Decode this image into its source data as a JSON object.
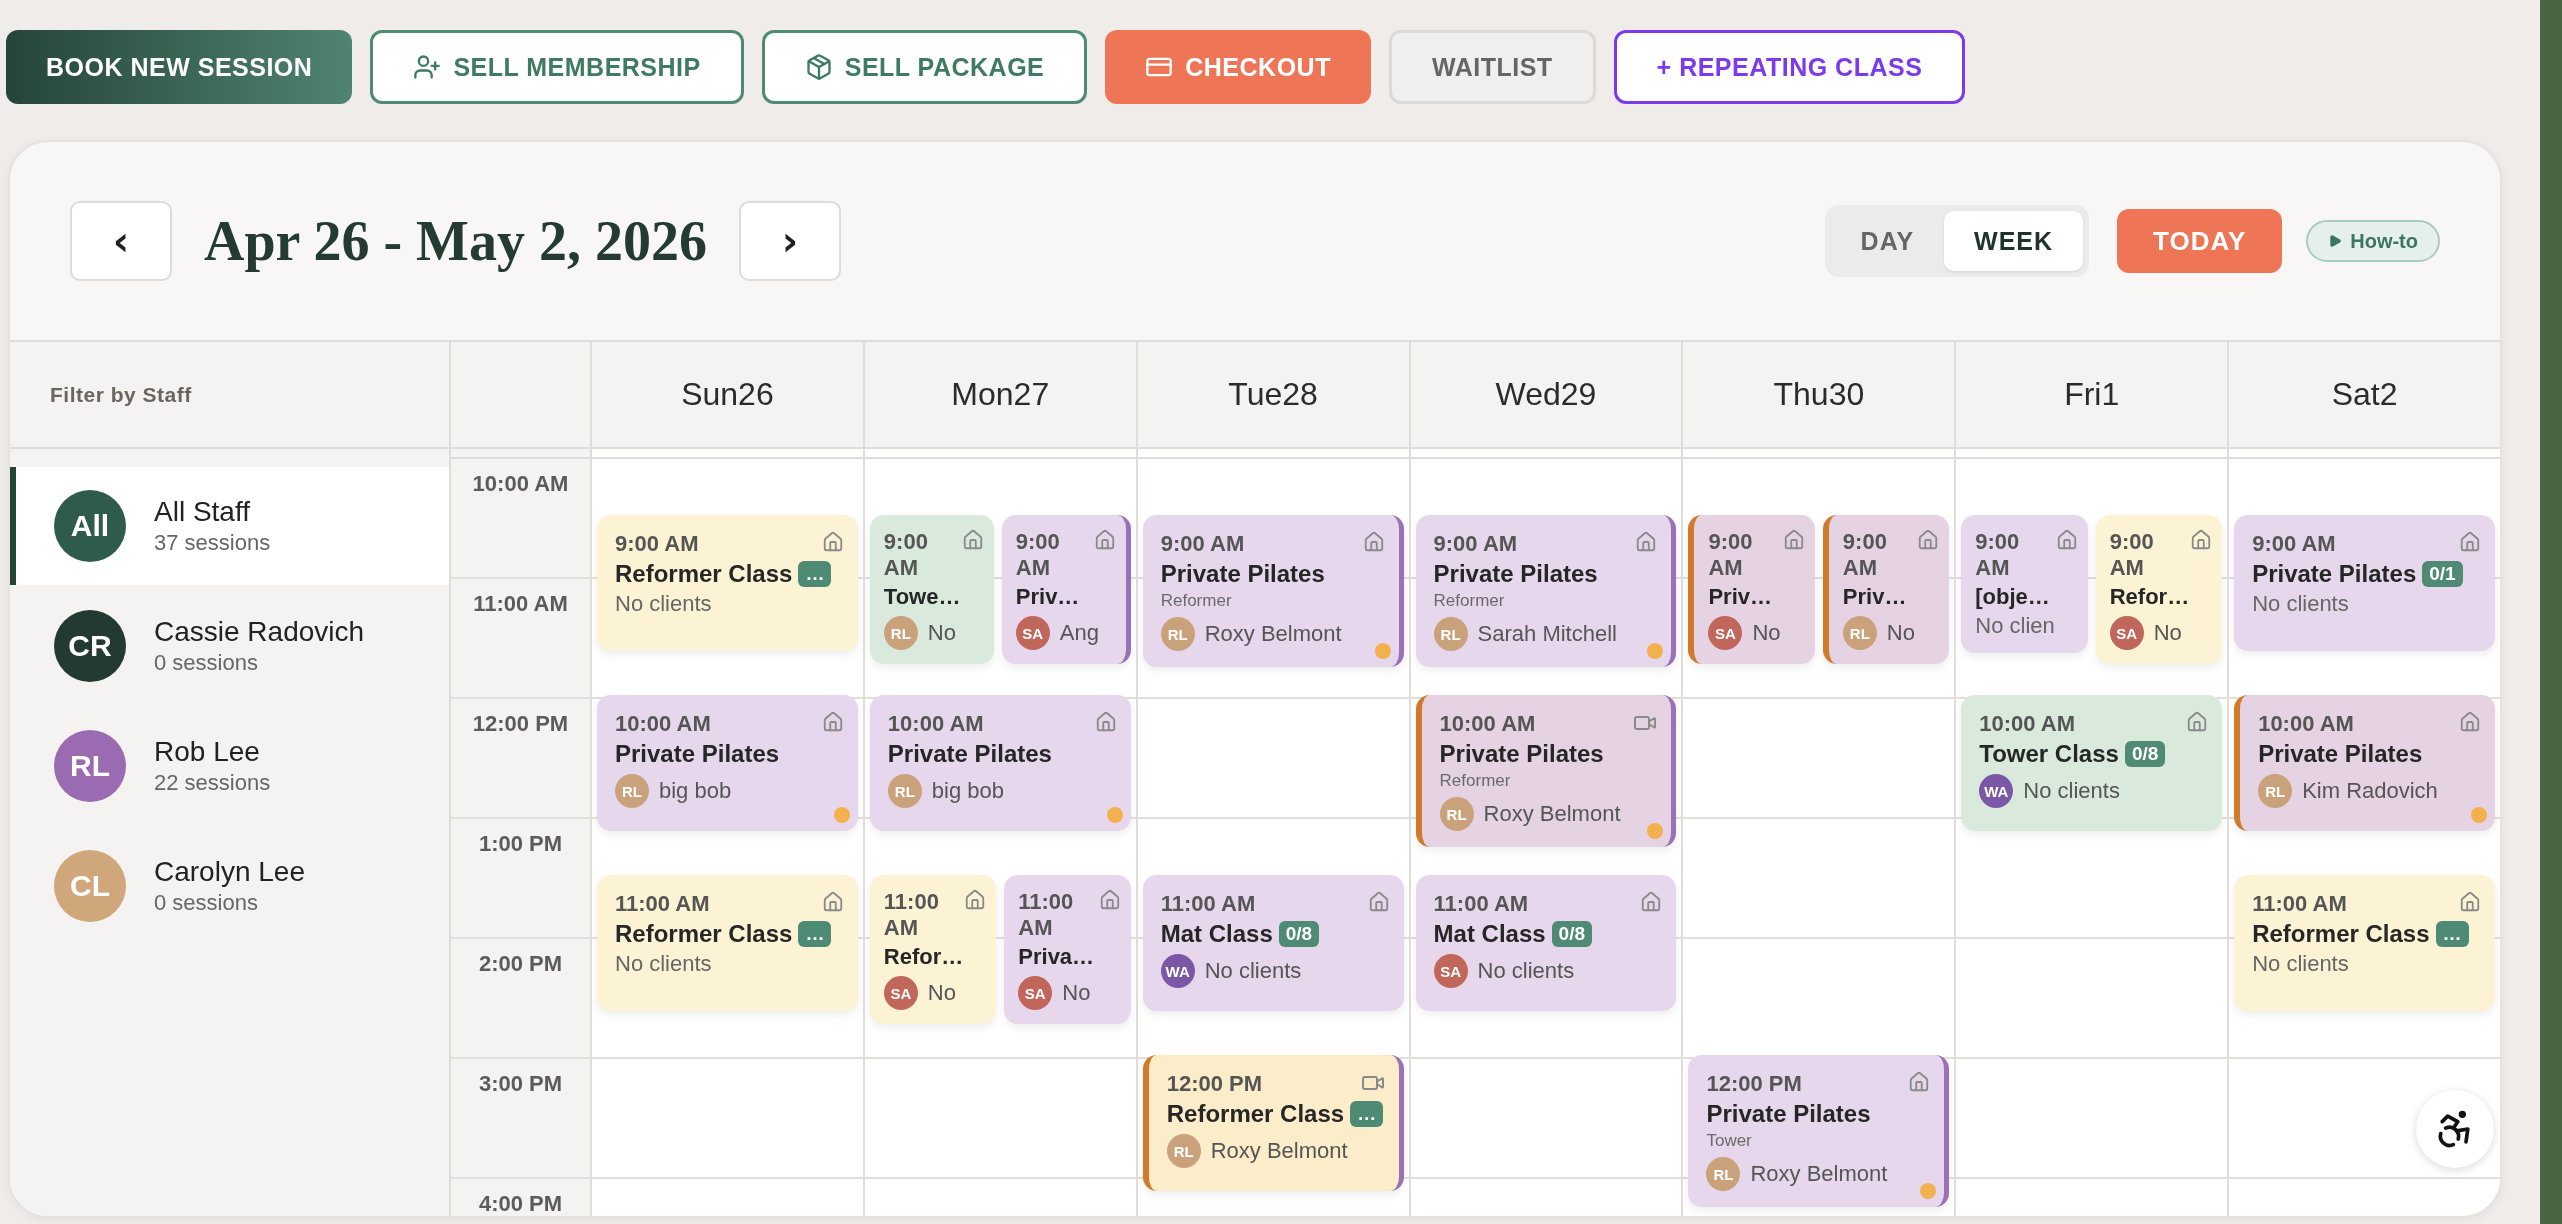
{
  "toolbar": [
    {
      "kind": "book",
      "label": "BOOK NEW SESSION"
    },
    {
      "kind": "membership",
      "label": "SELL MEMBERSHIP"
    },
    {
      "kind": "package",
      "label": "SELL PACKAGE"
    },
    {
      "kind": "checkout",
      "label": "CHECKOUT"
    },
    {
      "kind": "waitlist",
      "label": "WAITLIST"
    },
    {
      "kind": "repeating",
      "label": "+ REPEATING CLASS"
    }
  ],
  "calendar": {
    "prev": "‹",
    "next": "›",
    "title": "Apr 26 - May 2, 2026",
    "views": [
      {
        "label": "DAY",
        "selected": false
      },
      {
        "label": "WEEK",
        "selected": true
      }
    ],
    "today": "TODAY",
    "how_to": "How-to"
  },
  "staff_filter": {
    "heading": "Filter by Staff",
    "staff": [
      {
        "initials": "All",
        "name": "All Staff",
        "sessions": "37 sessions",
        "color": "#2f5b4c",
        "selected": true
      },
      {
        "initials": "CR",
        "name": "Cassie Radovich",
        "sessions": "0 sessions",
        "color": "#233a33",
        "selected": false
      },
      {
        "initials": "RL",
        "name": "Rob Lee",
        "sessions": "22 sessions",
        "color": "#9a6bb0",
        "selected": false
      },
      {
        "initials": "CL",
        "name": "Carolyn Lee",
        "sessions": "0 sessions",
        "color": "#cfa77a",
        "selected": false
      }
    ]
  },
  "times": [
    "10:00 AM",
    "11:00 AM",
    "12:00 PM",
    "1:00 PM",
    "2:00 PM",
    "3:00 PM",
    "4:00 PM"
  ],
  "days": [
    {
      "label": "Sun26",
      "slots": [
        {
          "kind": "nine",
          "events": [
            {
              "time": "9:00 AM",
              "title": "Reformer Class",
              "badge": "…",
              "note": "No clients",
              "kind": "in_person",
              "color": "#fbf3d3",
              "accent_left": false,
              "accent_right": false,
              "dot": false
            }
          ]
        },
        {
          "kind": "ten",
          "events": [
            {
              "time": "10:00 AM",
              "title": "Private Pilates",
              "client": {
                "initials": "RL",
                "name": "big bob",
                "color": "#c9a27c"
              },
              "kind": "in_person",
              "color": "#e6d7ec",
              "accent_left": false,
              "accent_right": false,
              "dot": true
            }
          ]
        },
        {
          "kind": "eleven",
          "events": [
            {
              "time": "11:00 AM",
              "title": "Reformer Class",
              "badge": "…",
              "note": "No clients",
              "kind": "in_person",
              "color": "#fbf3d3",
              "accent_left": false,
              "accent_right": false,
              "dot": false
            }
          ]
        }
      ]
    },
    {
      "label": "Mon27",
      "slots": [
        {
          "kind": "nine",
          "events": [
            {
              "time": "9:00 AM",
              "title": "Towe…",
              "client": {
                "initials": "RL",
                "name": "No",
                "color": "#c9a27c"
              },
              "kind": "in_person",
              "color": "#d9eadd",
              "accent_left": false,
              "accent_right": false,
              "dot": false
            },
            {
              "time": "9:00 AM",
              "title": "Priv…",
              "client": {
                "initials": "SA",
                "name": "Ang",
                "color": "#c1665a"
              },
              "kind": "in_person",
              "color": "#e6d7ec",
              "accent_left": false,
              "accent_right": true,
              "dot": false
            }
          ]
        },
        {
          "kind": "ten",
          "events": [
            {
              "time": "10:00 AM",
              "title": "Private Pilates",
              "client": {
                "initials": "RL",
                "name": "big bob",
                "color": "#c9a27c"
              },
              "kind": "in_person",
              "color": "#e6d7ec",
              "accent_left": false,
              "accent_right": false,
              "dot": true
            }
          ]
        },
        {
          "kind": "eleven",
          "events": [
            {
              "time": "11:00 AM",
              "title": "Refor…",
              "client": {
                "initials": "SA",
                "name": "No",
                "color": "#c1665a"
              },
              "kind": "in_person",
              "color": "#fbf3d3",
              "accent_left": false,
              "accent_right": false,
              "dot": false
            },
            {
              "time": "11:00 AM",
              "title": "Priva…",
              "client": {
                "initials": "SA",
                "name": "No",
                "color": "#c1665a"
              },
              "kind": "in_person",
              "color": "#e6d7ec",
              "accent_left": false,
              "accent_right": false,
              "dot": false
            }
          ]
        }
      ]
    },
    {
      "label": "Tue28",
      "slots": [
        {
          "kind": "nine",
          "events": [
            {
              "time": "9:00 AM",
              "title": "Private Pilates",
              "subtitle": "Reformer",
              "client": {
                "initials": "RL",
                "name": "Roxy Belmont",
                "color": "#c9a27c"
              },
              "kind": "in_person",
              "color": "#e6d7ec",
              "accent_left": false,
              "accent_right": true,
              "dot": true
            }
          ]
        },
        {
          "kind": "eleven",
          "events": [
            {
              "time": "11:00 AM",
              "title": "Mat Class",
              "badge": "0/8",
              "client": {
                "initials": "WA",
                "name": "No clients",
                "color": "#7a58a6"
              },
              "kind": "in_person",
              "color": "#e6d7ec",
              "accent_left": false,
              "accent_right": false,
              "dot": false
            }
          ]
        },
        {
          "kind": "noon",
          "events": [
            {
              "time": "12:00 PM",
              "title": "Reformer Class",
              "badge": "…",
              "client": {
                "initials": "RL",
                "name": "Roxy Belmont",
                "color": "#c9a27c"
              },
              "kind": "video",
              "color": "#fbedca",
              "accent_left": true,
              "accent_right": true,
              "dot": false
            }
          ]
        }
      ]
    },
    {
      "label": "Wed29",
      "slots": [
        {
          "kind": "nine",
          "events": [
            {
              "time": "9:00 AM",
              "title": "Private Pilates",
              "subtitle": "Reformer",
              "client": {
                "initials": "RL",
                "name": "Sarah Mitchell",
                "color": "#c9a27c"
              },
              "kind": "in_person",
              "color": "#e6d7ec",
              "accent_left": false,
              "accent_right": true,
              "dot": true
            }
          ]
        },
        {
          "kind": "ten",
          "events": [
            {
              "time": "10:00 AM",
              "title": "Private Pilates",
              "subtitle": "Reformer",
              "client": {
                "initials": "RL",
                "name": "Roxy Belmont",
                "color": "#c9a27c"
              },
              "kind": "video",
              "color": "#e5d3e3",
              "accent_left": true,
              "accent_right": true,
              "dot": true
            }
          ]
        },
        {
          "kind": "eleven",
          "events": [
            {
              "time": "11:00 AM",
              "title": "Mat Class",
              "badge": "0/8",
              "client": {
                "initials": "SA",
                "name": "No clients",
                "color": "#c1665a"
              },
              "kind": "in_person",
              "color": "#e6d7ec",
              "accent_left": false,
              "accent_right": false,
              "dot": false
            }
          ]
        }
      ]
    },
    {
      "label": "Thu30",
      "slots": [
        {
          "kind": "nine",
          "events": [
            {
              "time": "9:00 AM",
              "title": "Priv…",
              "client": {
                "initials": "SA",
                "name": "No",
                "color": "#c1665a"
              },
              "kind": "in_person",
              "color": "#e5d3e3",
              "accent_left": true,
              "accent_right": false,
              "dot": false
            },
            {
              "time": "9:00 AM",
              "title": "Priv…",
              "client": {
                "initials": "RL",
                "name": "No",
                "color": "#c9a27c"
              },
              "kind": "in_person",
              "color": "#e5d3e3",
              "accent_left": true,
              "accent_right": false,
              "dot": false
            }
          ]
        },
        {
          "kind": "noon",
          "events": [
            {
              "time": "12:00 PM",
              "title": "Private Pilates",
              "subtitle": "Tower",
              "client": {
                "initials": "RL",
                "name": "Roxy Belmont",
                "color": "#c9a27c"
              },
              "kind": "in_person",
              "color": "#e6d7ec",
              "accent_left": false,
              "accent_right": true,
              "dot": true
            }
          ]
        }
      ]
    },
    {
      "label": "Fri1",
      "slots": [
        {
          "kind": "nine",
          "events": [
            {
              "time": "9:00 AM",
              "title": "[obje…",
              "note": "No clien",
              "kind": "in_person",
              "color": "#e6d7ec",
              "accent_left": false,
              "accent_right": false,
              "dot": false
            },
            {
              "time": "9:00 AM",
              "title": "Refor…",
              "client": {
                "initials": "SA",
                "name": "No",
                "color": "#c1665a"
              },
              "kind": "in_person",
              "color": "#fbf3d3",
              "accent_left": false,
              "accent_right": false,
              "dot": false
            }
          ]
        },
        {
          "kind": "ten",
          "events": [
            {
              "time": "10:00 AM",
              "title": "Tower Class",
              "badge": "0/8",
              "client": {
                "initials": "WA",
                "name": "No clients",
                "color": "#7a58a6"
              },
              "kind": "in_person",
              "color": "#d9eadd",
              "accent_left": false,
              "accent_right": false,
              "dot": false
            }
          ]
        }
      ]
    },
    {
      "label": "Sat2",
      "slots": [
        {
          "kind": "nine",
          "events": [
            {
              "time": "9:00 AM",
              "title": "Private Pilates",
              "badge": "0/1",
              "note": "No clients",
              "kind": "in_person",
              "color": "#e6d7ec",
              "accent_left": false,
              "accent_right": false,
              "dot": false
            }
          ]
        },
        {
          "kind": "ten",
          "events": [
            {
              "time": "10:00 AM",
              "title": "Private Pilates",
              "client": {
                "initials": "RL",
                "name": "Kim Radovich",
                "color": "#c9a27c"
              },
              "kind": "in_person",
              "color": "#e5d3e3",
              "accent_left": true,
              "accent_right": false,
              "dot": true
            }
          ]
        },
        {
          "kind": "eleven",
          "events": [
            {
              "time": "11:00 AM",
              "title": "Reformer Class",
              "badge": "…",
              "note": "No clients",
              "kind": "in_person",
              "color": "#fbf3d3",
              "accent_left": false,
              "accent_right": false,
              "dot": false
            }
          ]
        }
      ]
    }
  ]
}
